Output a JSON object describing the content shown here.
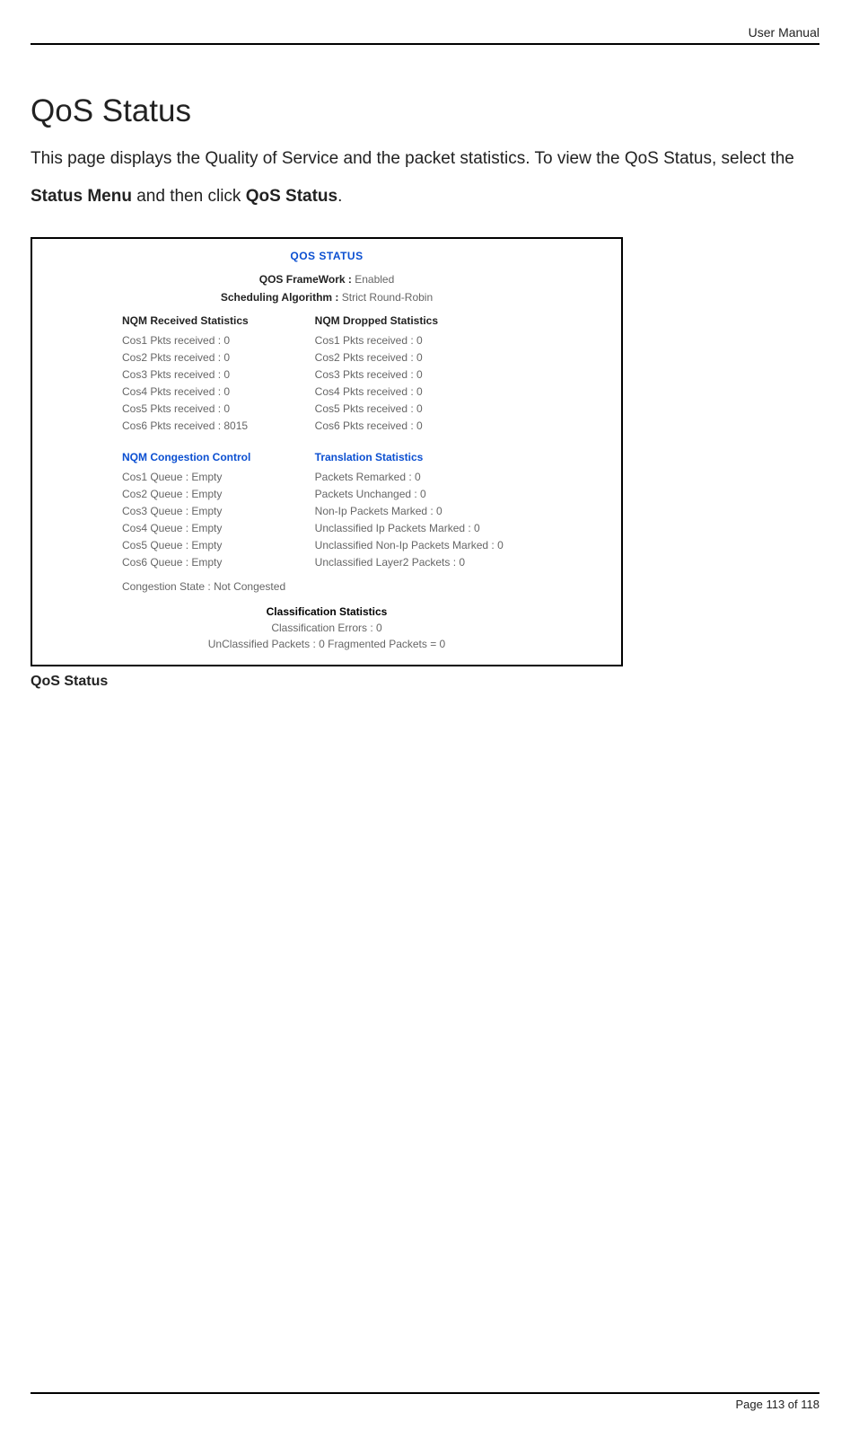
{
  "header": {
    "label": "User Manual"
  },
  "title": "QoS Status",
  "intro": {
    "pre": "This page displays the Quality of Service and the packet statistics. To view the QoS Status, select the ",
    "bold1": "Status Menu",
    "mid": " and then click ",
    "bold2": "QoS Status",
    "post": "."
  },
  "screenshot": {
    "title": "QOS STATUS",
    "framework": {
      "label": "QOS FrameWork :",
      "value": "Enabled"
    },
    "scheduling": {
      "label": "Scheduling Algorithm :",
      "value": "Strict Round-Robin"
    },
    "nqm_received": {
      "heading": "NQM Received Statistics",
      "rows": [
        "Cos1 Pkts received : 0",
        "Cos2 Pkts received : 0",
        "Cos3 Pkts received : 0",
        "Cos4 Pkts received : 0",
        "Cos5 Pkts received : 0",
        "Cos6 Pkts received : 8015"
      ]
    },
    "nqm_dropped": {
      "heading": "NQM Dropped Statistics",
      "rows": [
        "Cos1 Pkts received : 0",
        "Cos2 Pkts received : 0",
        "Cos3 Pkts received : 0",
        "Cos4 Pkts received : 0",
        "Cos5 Pkts received : 0",
        "Cos6 Pkts received : 0"
      ]
    },
    "nqm_congestion": {
      "heading": "NQM Congestion Control",
      "rows": [
        "Cos1 Queue : Empty",
        "Cos2 Queue : Empty",
        "Cos3 Queue : Empty",
        "Cos4 Queue : Empty",
        "Cos5 Queue : Empty",
        "Cos6 Queue : Empty"
      ],
      "state": "Congestion State : Not Congested"
    },
    "translation": {
      "heading": "Translation Statistics",
      "rows": [
        "Packets Remarked : 0",
        "Packets Unchanged : 0",
        "Non-Ip Packets Marked : 0",
        "Unclassified Ip Packets Marked : 0",
        "Unclassified Non-Ip Packets Marked : 0",
        "Unclassified Layer2 Packets : 0"
      ]
    },
    "classification": {
      "heading": "Classification Statistics",
      "row1": "Classification Errors : 0",
      "row2": "UnClassified Packets : 0 Fragmented Packets = 0"
    }
  },
  "caption": "QoS Status",
  "footer": {
    "page": "Page 113 of 118"
  }
}
